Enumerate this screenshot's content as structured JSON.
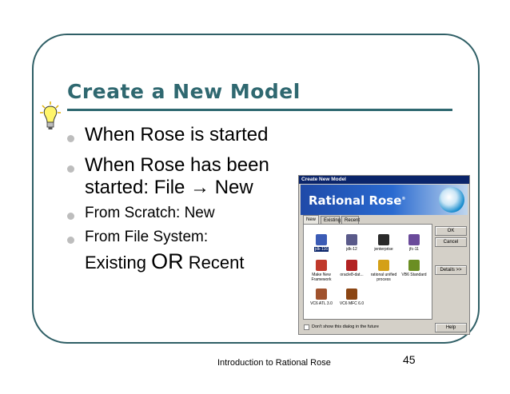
{
  "slide": {
    "title": "Create a New Model",
    "bullets": [
      {
        "text": "When Rose is started"
      },
      {
        "line1": "When Rose has been",
        "line2": "started:  File → New"
      },
      {
        "text": "From Scratch: New"
      },
      {
        "text": "From File System:"
      }
    ],
    "last_line": {
      "a": "Existing ",
      "b": "OR",
      "c": " Recent"
    },
    "footer": "Introduction to Rational Rose",
    "page_number": "45"
  },
  "dialog": {
    "title": "Create New Model",
    "banner": "Rational Rose",
    "banner_mark": "®",
    "tabs": [
      "New",
      "Existing",
      "Recent"
    ],
    "items": [
      {
        "label": "jdk-116",
        "color": "#3b5bb5"
      },
      {
        "label": "jdk-12",
        "color": "#5a5a8a"
      },
      {
        "label": "jenterprise",
        "color": "#2a2a2a"
      },
      {
        "label": "jfc-11",
        "color": "#6a4a9a"
      },
      {
        "label": "Make New Framework",
        "color": "#c0392b"
      },
      {
        "label": "oracle8-dat...",
        "color": "#b22222"
      },
      {
        "label": "rational unified process",
        "color": "#d4a017"
      },
      {
        "label": "VB6 Standard",
        "color": "#6b8e23"
      },
      {
        "label": "VC6 ATL 3.0",
        "color": "#a0522d"
      },
      {
        "label": "VC6 MFC 6.0",
        "color": "#8b4513"
      }
    ],
    "buttons": {
      "ok": "OK",
      "cancel": "Cancel",
      "details": "Details >>",
      "help": "Help"
    },
    "checkbox_label": "Don't show this dialog in the future"
  }
}
